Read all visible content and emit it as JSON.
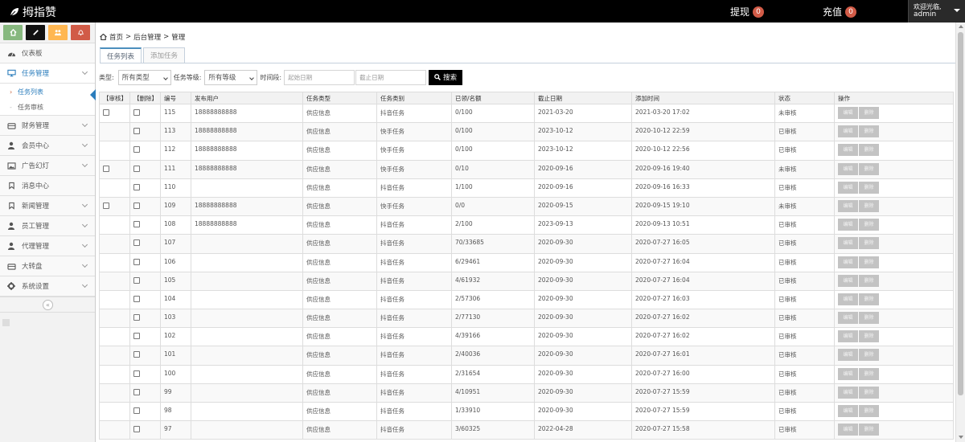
{
  "app": {
    "brand": "拇指赞"
  },
  "navbar": {
    "withdraw_label": "提现",
    "withdraw_count": "0",
    "recharge_label": "充值",
    "recharge_count": "0",
    "welcome": "欢迎光临,",
    "username": "admin"
  },
  "sidebar": {
    "shortcuts": [
      "home-icon",
      "pencil-icon",
      "users-icon",
      "bell-icon"
    ],
    "items": [
      {
        "label": "仪表板",
        "icon": "dashboard-icon"
      },
      {
        "label": "任务管理",
        "icon": "desktop-icon"
      },
      {
        "label": "财务管理",
        "icon": "wallet-icon"
      },
      {
        "label": "会员中心",
        "icon": "user-icon"
      },
      {
        "label": "广告幻灯",
        "icon": "picture-icon"
      },
      {
        "label": "消息中心",
        "icon": "bookmark-icon"
      },
      {
        "label": "新闻管理",
        "icon": "bookmark-icon"
      },
      {
        "label": "员工管理",
        "icon": "user-icon"
      },
      {
        "label": "代理管理",
        "icon": "user-icon"
      },
      {
        "label": "大转盘",
        "icon": "wallet-icon"
      },
      {
        "label": "系统设置",
        "icon": "gear-icon"
      }
    ],
    "task_sub": [
      "任务列表",
      "任务审核"
    ]
  },
  "breadcrumb": {
    "home": "首页",
    "sep": ">",
    "level1": "后台管理",
    "level2": "管理"
  },
  "tabs": {
    "list": "任务列表",
    "add": "添加任务"
  },
  "filters": {
    "type_label": "类型:",
    "type_value": "所有类型",
    "level_label": "任务等级:",
    "level_value": "所有等级",
    "time_label": "时间段:",
    "start_placeholder": "起始日期",
    "end_placeholder": "截止日期",
    "search_label": "搜索"
  },
  "table": {
    "headers": [
      "【审核】",
      "【删除】",
      "编号",
      "发布用户",
      "任务类型",
      "任务类别",
      "已领/名额",
      "截止日期",
      "添加时间",
      "状态",
      "操作"
    ],
    "edit_label": "编辑",
    "delete_label": "删除",
    "rows": [
      {
        "audit": true,
        "id": "115",
        "user": "18888888888",
        "type": "供应信息",
        "category": "抖音任务",
        "quota": "0/100",
        "deadline": "2021-03-20",
        "added": "2021-03-20 17:02",
        "status": "未审核",
        "pending": true
      },
      {
        "audit": false,
        "id": "113",
        "user": "18888888888",
        "type": "供应信息",
        "category": "快手任务",
        "quota": "0/100",
        "deadline": "2023-10-12",
        "added": "2020-10-12 22:59",
        "status": "已审核",
        "pending": false
      },
      {
        "audit": false,
        "id": "112",
        "user": "18888888888",
        "type": "供应信息",
        "category": "快手任务",
        "quota": "0/100",
        "deadline": "2023-10-12",
        "added": "2020-10-12 22:56",
        "status": "已审核",
        "pending": false
      },
      {
        "audit": true,
        "id": "111",
        "user": "18888888888",
        "type": "供应信息",
        "category": "快手任务",
        "quota": "0/10",
        "deadline": "2020-09-16",
        "added": "2020-09-16 19:40",
        "status": "未审核",
        "pending": true
      },
      {
        "audit": false,
        "id": "110",
        "user": "",
        "type": "供应信息",
        "category": "抖音任务",
        "quota": "1/100",
        "deadline": "2020-09-16",
        "added": "2020-09-16 16:33",
        "status": "已审核",
        "pending": false
      },
      {
        "audit": true,
        "id": "109",
        "user": "18888888888",
        "type": "供应信息",
        "category": "快手任务",
        "quota": "0/0",
        "deadline": "2020-09-15",
        "added": "2020-09-15 19:10",
        "status": "未审核",
        "pending": true
      },
      {
        "audit": false,
        "id": "108",
        "user": "18888888888",
        "type": "供应信息",
        "category": "抖音任务",
        "quota": "2/100",
        "deadline": "2023-09-13",
        "added": "2020-09-13 10:51",
        "status": "已审核",
        "pending": false
      },
      {
        "audit": false,
        "id": "107",
        "user": "",
        "type": "供应信息",
        "category": "抖音任务",
        "quota": "70/33685",
        "deadline": "2020-09-30",
        "added": "2020-07-27 16:05",
        "status": "已审核",
        "pending": false
      },
      {
        "audit": false,
        "id": "106",
        "user": "",
        "type": "供应信息",
        "category": "抖音任务",
        "quota": "6/29461",
        "deadline": "2020-09-30",
        "added": "2020-07-27 16:04",
        "status": "已审核",
        "pending": false
      },
      {
        "audit": false,
        "id": "105",
        "user": "",
        "type": "供应信息",
        "category": "抖音任务",
        "quota": "4/61932",
        "deadline": "2020-09-30",
        "added": "2020-07-27 16:04",
        "status": "已审核",
        "pending": false
      },
      {
        "audit": false,
        "id": "104",
        "user": "",
        "type": "供应信息",
        "category": "抖音任务",
        "quota": "2/57306",
        "deadline": "2020-09-30",
        "added": "2020-07-27 16:03",
        "status": "已审核",
        "pending": false
      },
      {
        "audit": false,
        "id": "103",
        "user": "",
        "type": "供应信息",
        "category": "抖音任务",
        "quota": "2/77130",
        "deadline": "2020-09-30",
        "added": "2020-07-27 16:02",
        "status": "已审核",
        "pending": false
      },
      {
        "audit": false,
        "id": "102",
        "user": "",
        "type": "供应信息",
        "category": "抖音任务",
        "quota": "4/39166",
        "deadline": "2020-09-30",
        "added": "2020-07-27 16:02",
        "status": "已审核",
        "pending": false
      },
      {
        "audit": false,
        "id": "101",
        "user": "",
        "type": "供应信息",
        "category": "抖音任务",
        "quota": "2/40036",
        "deadline": "2020-09-30",
        "added": "2020-07-27 16:01",
        "status": "已审核",
        "pending": false
      },
      {
        "audit": false,
        "id": "100",
        "user": "",
        "type": "供应信息",
        "category": "抖音任务",
        "quota": "2/31654",
        "deadline": "2020-09-30",
        "added": "2020-07-27 16:00",
        "status": "已审核",
        "pending": false
      },
      {
        "audit": false,
        "id": "99",
        "user": "",
        "type": "供应信息",
        "category": "抖音任务",
        "quota": "4/10951",
        "deadline": "2020-09-30",
        "added": "2020-07-27 15:59",
        "status": "已审核",
        "pending": false
      },
      {
        "audit": false,
        "id": "98",
        "user": "",
        "type": "供应信息",
        "category": "抖音任务",
        "quota": "1/33910",
        "deadline": "2020-09-30",
        "added": "2020-07-27 15:59",
        "status": "已审核",
        "pending": false
      },
      {
        "audit": false,
        "id": "97",
        "user": "",
        "type": "供应信息",
        "category": "抖音任务",
        "quota": "3/60325",
        "deadline": "2022-04-28",
        "added": "2020-07-27 15:58",
        "status": "已审核",
        "pending": false
      }
    ]
  },
  "colors": {
    "accent": "#2b7dbc",
    "badge": "#d15b47",
    "pending": "#d15b47"
  }
}
